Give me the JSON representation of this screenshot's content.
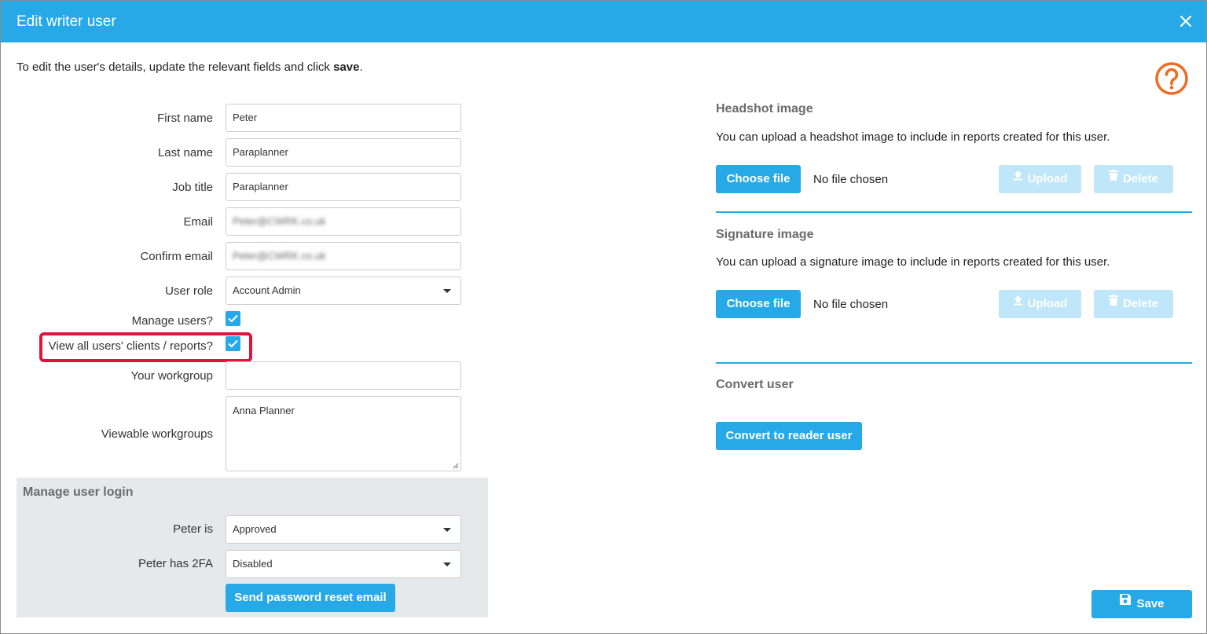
{
  "dialog": {
    "title": "Edit writer user",
    "intro_prefix": "To edit the user's details, update the relevant fields and click ",
    "intro_bold": "save",
    "intro_suffix": "."
  },
  "form": {
    "first_name": {
      "label": "First name",
      "value": "Peter"
    },
    "last_name": {
      "label": "Last name",
      "value": "Paraplanner"
    },
    "job_title": {
      "label": "Job title",
      "value": "Paraplanner"
    },
    "email": {
      "label": "Email",
      "value": "Peter@CWRK.co.uk"
    },
    "confirm_email": {
      "label": "Confirm email",
      "value": "Peter@CWRK.co.uk"
    },
    "user_role": {
      "label": "User role",
      "value": "Account Admin"
    },
    "manage_users": {
      "label": "Manage users?",
      "checked": true
    },
    "view_all": {
      "label": "View all users' clients / reports?",
      "checked": true
    },
    "your_workgroup": {
      "label": "Your workgroup",
      "value": ""
    },
    "viewable_workgroups": {
      "label": "Viewable workgroups",
      "value": "Anna Planner"
    }
  },
  "login": {
    "title": "Manage user login",
    "status": {
      "label": "Peter is",
      "value": "Approved"
    },
    "twofa": {
      "label": "Peter has 2FA",
      "value": "Disabled"
    },
    "reset_button": "Send password reset email"
  },
  "headshot": {
    "title": "Headshot image",
    "text": "You can upload a headshot image to include in reports created for this user.",
    "choose": "Choose file",
    "no_file": "No file chosen",
    "upload": "Upload",
    "delete": "Delete"
  },
  "signature": {
    "title": "Signature image",
    "text": "You can upload a signature image to include in reports created for this user.",
    "choose": "Choose file",
    "no_file": "No file chosen",
    "upload": "Upload",
    "delete": "Delete"
  },
  "convert": {
    "title": "Convert user",
    "button": "Convert to reader user"
  },
  "footer": {
    "save": "Save"
  },
  "colors": {
    "accent": "#27a9e8",
    "help": "#ee6b22",
    "highlight": "#e3123b"
  }
}
